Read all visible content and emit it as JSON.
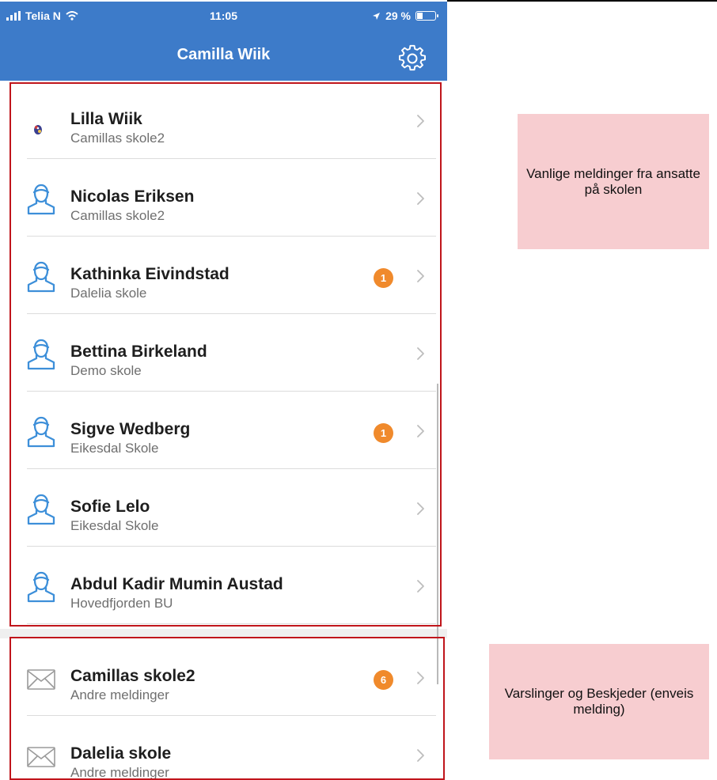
{
  "status": {
    "carrier": "Telia N",
    "time": "11:05",
    "battery": "29 %"
  },
  "header": {
    "title": "Camilla Wiik"
  },
  "contacts": [
    {
      "name": "Lilla Wiik",
      "school": "Camillas skole2",
      "badge": "",
      "icon": "photo-avatar-icon"
    },
    {
      "name": "Nicolas Eriksen",
      "school": "Camillas skole2",
      "badge": "",
      "icon": "user-icon"
    },
    {
      "name": "Kathinka Eivindstad",
      "school": "Dalelia skole",
      "badge": "1",
      "icon": "user-icon"
    },
    {
      "name": "Bettina Birkeland",
      "school": "Demo skole",
      "badge": "",
      "icon": "user-icon"
    },
    {
      "name": "Sigve Wedberg",
      "school": "Eikesdal Skole",
      "badge": "1",
      "icon": "user-icon"
    },
    {
      "name": "Sofie Lelo",
      "school": "Eikesdal Skole",
      "badge": "",
      "icon": "user-icon"
    },
    {
      "name": "Abdul Kadir Mumin Austad",
      "school": "Hovedfjorden BU",
      "badge": "",
      "icon": "user-icon"
    }
  ],
  "notices": [
    {
      "name": "Camillas skole2",
      "sub": "Andre meldinger",
      "badge": "6",
      "icon": "envelope-icon"
    },
    {
      "name": "Dalelia skole",
      "sub": "Andre meldinger",
      "badge": "",
      "icon": "envelope-icon"
    }
  ],
  "annotations": {
    "messages": "Vanlige meldinger fra ansatte på skolen",
    "notices": "Varslinger og Beskjeder (enveis melding)"
  },
  "colors": {
    "header": "#3d7bc9",
    "badge": "#f08a2c",
    "frame": "#c0151b",
    "note": "#f7cdd0",
    "icon": "#3d8fd9"
  }
}
